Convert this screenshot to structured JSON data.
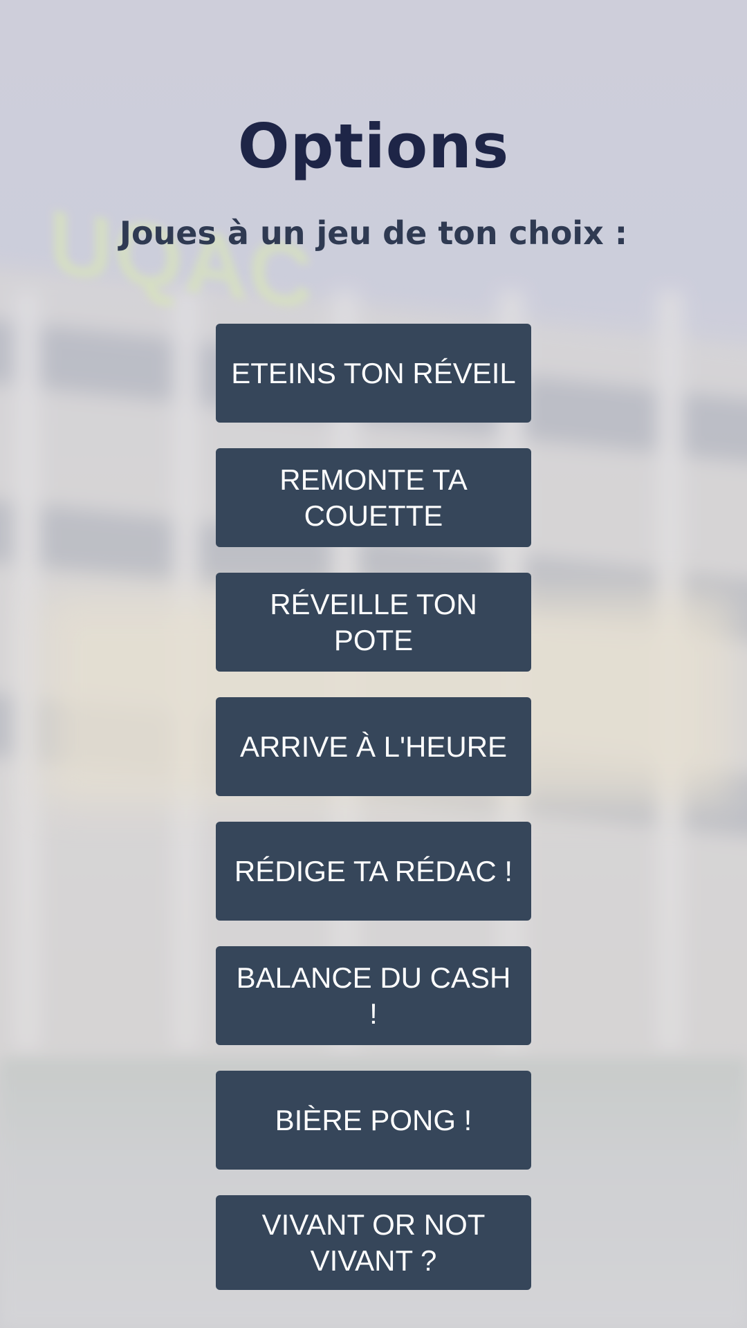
{
  "page": {
    "title": "Options",
    "subtitle": "Joues à un jeu de ton choix :"
  },
  "background": {
    "sign_text": "UQAC"
  },
  "menu": {
    "items": [
      {
        "label": "ETEINS TON RÉVEIL"
      },
      {
        "label": "REMONTE TA COUETTE"
      },
      {
        "label": "RÉVEILLE TON POTE"
      },
      {
        "label": "ARRIVE À L'HEURE"
      },
      {
        "label": "RÉDIGE TA RÉDAC !"
      },
      {
        "label": "BALANCE DU CASH !"
      },
      {
        "label": "BIÈRE PONG !"
      },
      {
        "label": "VIVANT OR NOT VIVANT ?"
      }
    ]
  },
  "colors": {
    "button_background": "#36465a",
    "button_text": "#ffffff",
    "title": "#1e2547",
    "subtitle": "#2f3a52"
  }
}
